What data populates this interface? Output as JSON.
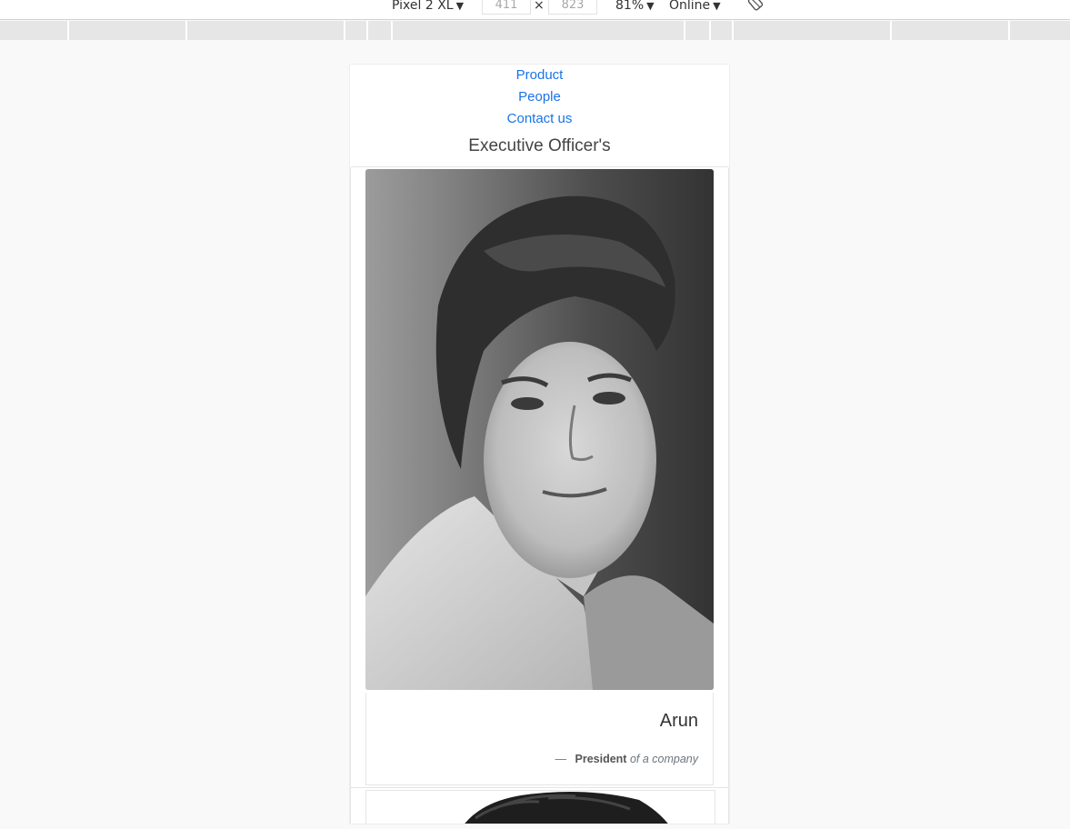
{
  "devtools": {
    "device": "Pixel 2 XL",
    "width": "411",
    "height": "823",
    "zoom": "81%",
    "network": "Online",
    "times": "×"
  },
  "nav": {
    "links": [
      "Product",
      "People",
      "Contact us"
    ]
  },
  "section_title": "Executive Officer's",
  "card": {
    "name": "Arun",
    "footer_dash": "—",
    "footer_title": "President",
    "footer_rest": "of a company"
  },
  "colors": {
    "link": "#1a73e8",
    "muted": "#6c757d"
  }
}
